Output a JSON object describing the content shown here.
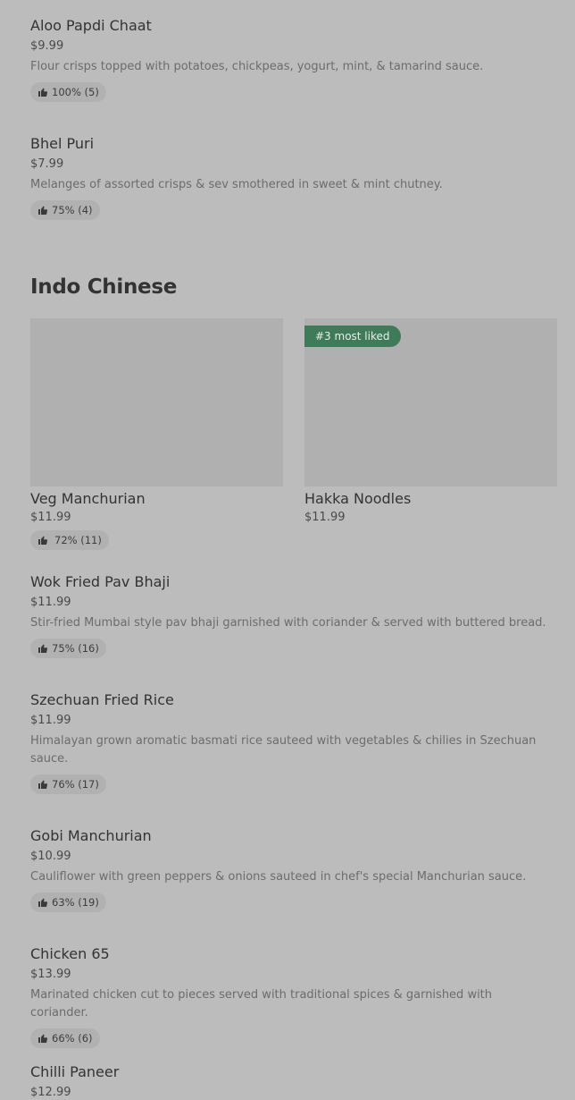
{
  "items_top": [
    {
      "name": "Aloo Papdi Chaat",
      "price": "$9.99",
      "description": "Flour crisps topped with potatoes, chickpeas, yogurt, mint, & tamarind sauce.",
      "rating": "100% (5)"
    },
    {
      "name": "Bhel Puri",
      "price": "$7.99",
      "description": "Melanges of assorted crisps & sev smothered in sweet & mint chutney.",
      "rating": "75% (4)"
    }
  ],
  "section": {
    "title": "Indo Chinese"
  },
  "cards": [
    {
      "name": "Veg Manchurian",
      "price": "$11.99",
      "rating": "72% (11)",
      "badge": ""
    },
    {
      "name": "Hakka Noodles",
      "price": "$11.99",
      "rating": "",
      "badge": "#3 most liked"
    }
  ],
  "items_bottom": [
    {
      "name": "Wok Fried Pav Bhaji",
      "price": "$11.99",
      "description": "Stir-fried Mumbai style pav bhaji garnished with coriander & served with buttered bread.",
      "rating": "75% (16)"
    },
    {
      "name": "Szechuan Fried Rice",
      "price": "$11.99",
      "description": "Himalayan grown aromatic basmati rice sauteed with vegetables & chilies in Szechuan sauce.",
      "rating": "76% (17)"
    },
    {
      "name": "Gobi Manchurian",
      "price": "$10.99",
      "description": "Cauliflower with green peppers & onions sauteed in chef's special Manchurian sauce.",
      "rating": "63% (19)"
    },
    {
      "name": "Chicken 65",
      "price": "$13.99",
      "description": "Marinated chicken cut to pieces served with traditional spices & garnished with coriander.",
      "rating": "66% (6)"
    },
    {
      "name": "Chilli Paneer",
      "price": "$12.99",
      "description": "",
      "rating": ""
    }
  ],
  "colors": {
    "background": "#bcbcbc",
    "badge": "#3f7a59",
    "pill": "#b1b1b1"
  },
  "icons": {
    "rating": "thumbs-up-icon"
  }
}
